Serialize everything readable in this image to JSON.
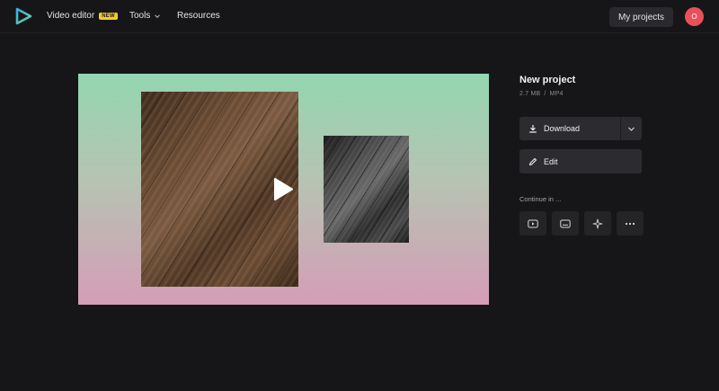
{
  "header": {
    "nav": [
      {
        "label": "Video editor",
        "badge": "NEW"
      },
      {
        "label": "Tools"
      },
      {
        "label": "Resources"
      }
    ],
    "my_projects_label": "My projects",
    "avatar_initial": "O"
  },
  "project": {
    "title": "New project",
    "size": "2.7 MB",
    "separator": "/",
    "format": "MP4"
  },
  "actions": {
    "download_label": "Download",
    "edit_label": "Edit"
  },
  "continue": {
    "label": "Continue in ...",
    "icons": [
      "youtube-icon",
      "subtitles-icon",
      "sparkle-icon",
      "more-icon"
    ]
  },
  "colors": {
    "brand_blue": "#3bb0e6",
    "brand_green": "#5dd39e",
    "badge": "#f4cc2a",
    "avatar": "#e8505b",
    "background": "#161618"
  }
}
